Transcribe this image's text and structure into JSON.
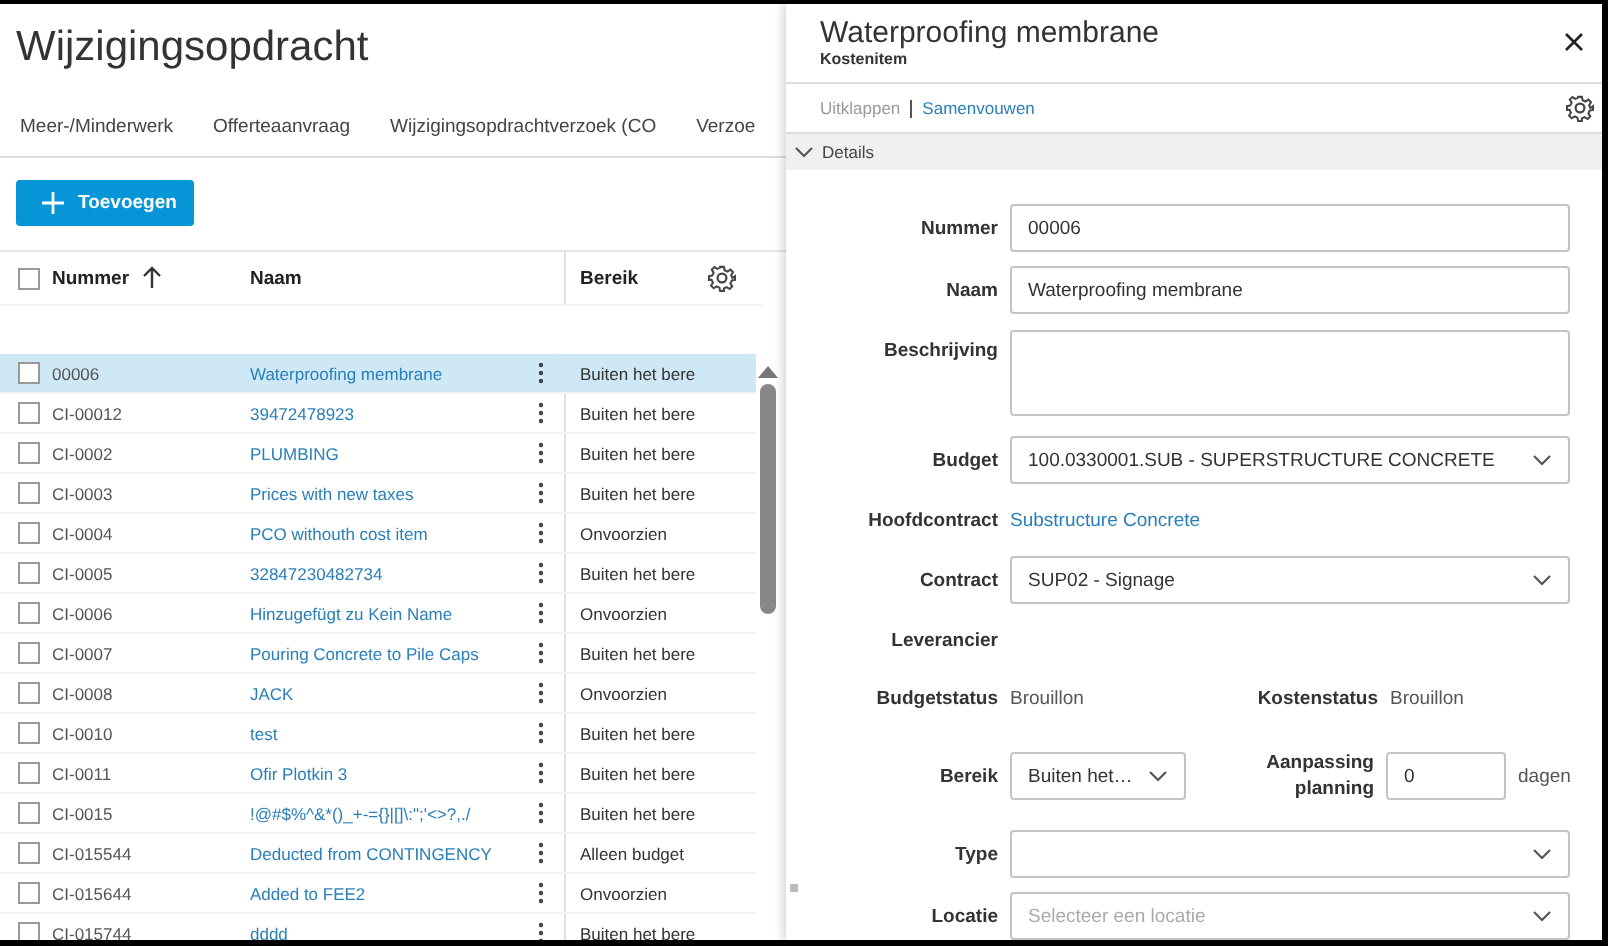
{
  "page": {
    "title": "Wijzigingsopdracht"
  },
  "tabs": [
    {
      "label": "Meer-/Minderwerk",
      "selected": false
    },
    {
      "label": "Offerteaanvraag",
      "selected": false
    },
    {
      "label": "Wijzigingsopdrachtverzoek (CO",
      "selected": false
    },
    {
      "label": "Verzoe",
      "selected": false
    }
  ],
  "add_button": {
    "label": "Toevoegen"
  },
  "table": {
    "all_checked": false,
    "columns": [
      {
        "label": "Nummer",
        "sorted": true
      },
      {
        "label": "Naam",
        "sorted": false
      },
      {
        "label": "Bereik",
        "sorted": false
      }
    ],
    "rows": [
      {
        "number": "00006",
        "name": "Waterproofing membrane",
        "scope": "Buiten het bere",
        "selected": true,
        "checked": false
      },
      {
        "number": "CI-00012",
        "name": "39472478923",
        "scope": "Buiten het bere",
        "selected": false,
        "checked": false
      },
      {
        "number": "CI-0002",
        "name": "PLUMBING",
        "scope": "Buiten het bere",
        "selected": false,
        "checked": false
      },
      {
        "number": "CI-0003",
        "name": "Prices with new taxes",
        "scope": "Buiten het bere",
        "selected": false,
        "checked": false
      },
      {
        "number": "CI-0004",
        "name": "PCO withouth cost item",
        "scope": "Onvoorzien",
        "selected": false,
        "checked": false
      },
      {
        "number": "CI-0005",
        "name": "32847230482734",
        "scope": "Buiten het bere",
        "selected": false,
        "checked": false
      },
      {
        "number": "CI-0006",
        "name": "Hinzugefügt zu Kein Name",
        "scope": "Onvoorzien",
        "selected": false,
        "checked": false
      },
      {
        "number": "CI-0007",
        "name": "Pouring Concrete to Pile Caps",
        "scope": "Buiten het bere",
        "selected": false,
        "checked": false
      },
      {
        "number": "CI-0008",
        "name": "JACK",
        "scope": "Onvoorzien",
        "selected": false,
        "checked": false
      },
      {
        "number": "CI-0010",
        "name": "test",
        "scope": "Buiten het bere",
        "selected": false,
        "checked": false
      },
      {
        "number": "CI-0011",
        "name": "Ofir Plotkin 3",
        "scope": "Buiten het bere",
        "selected": false,
        "checked": false
      },
      {
        "number": "CI-0015",
        "name": "!@#$%^&*()_+-={}|[]\\:\";'<>?,./",
        "scope": "Buiten het bere",
        "selected": false,
        "checked": false
      },
      {
        "number": "CI-015544",
        "name": "Deducted from CONTINGENCY",
        "scope": "Alleen budget",
        "selected": false,
        "checked": false
      },
      {
        "number": "CI-015644",
        "name": "Added to FEE2",
        "scope": "Onvoorzien",
        "selected": false,
        "checked": false
      },
      {
        "number": "CI-015744",
        "name": "dddd",
        "scope": "Buiten het bere",
        "selected": false,
        "checked": false
      }
    ]
  },
  "panel": {
    "title": "Waterproofing membrane",
    "subtitle": "Kostenitem",
    "links": [
      {
        "label": "Uitklappen",
        "disabled": true
      },
      {
        "label": "Samenvouwen",
        "disabled": false
      }
    ],
    "section": {
      "label": "Details",
      "expanded": true
    },
    "fields": [
      {
        "kind": "input",
        "label": "Nummer",
        "value": "00006"
      },
      {
        "kind": "input",
        "label": "Naam",
        "value": "Waterproofing membrane"
      },
      {
        "kind": "textarea",
        "label": "Beschrijving"
      },
      {
        "kind": "select",
        "label": "Budget",
        "value": "100.0330001.SUB - SUPERSTRUCTURE CONCRETE"
      },
      {
        "kind": "link",
        "label": "Hoofdcontract",
        "value": "Substructure Concrete"
      },
      {
        "kind": "select",
        "label": "Contract",
        "value": "SUP02 - Signage"
      },
      {
        "kind": "text",
        "label": "Leverancier"
      },
      {
        "kind": "pair",
        "items": [
          {
            "label": "Budgetstatus",
            "value": "Brouillon"
          },
          {
            "label": "Kostenstatus",
            "value": "Brouillon"
          }
        ]
      },
      {
        "kind": "schedule",
        "label": "Bereik",
        "value": "Buiten het…",
        "label2": "Aanpassing planning",
        "value2": "0",
        "unit": "dagen"
      },
      {
        "kind": "select",
        "label": "Type"
      },
      {
        "kind": "select",
        "label": "Locatie",
        "placeholder": "Selecteer een locatie"
      }
    ]
  }
}
